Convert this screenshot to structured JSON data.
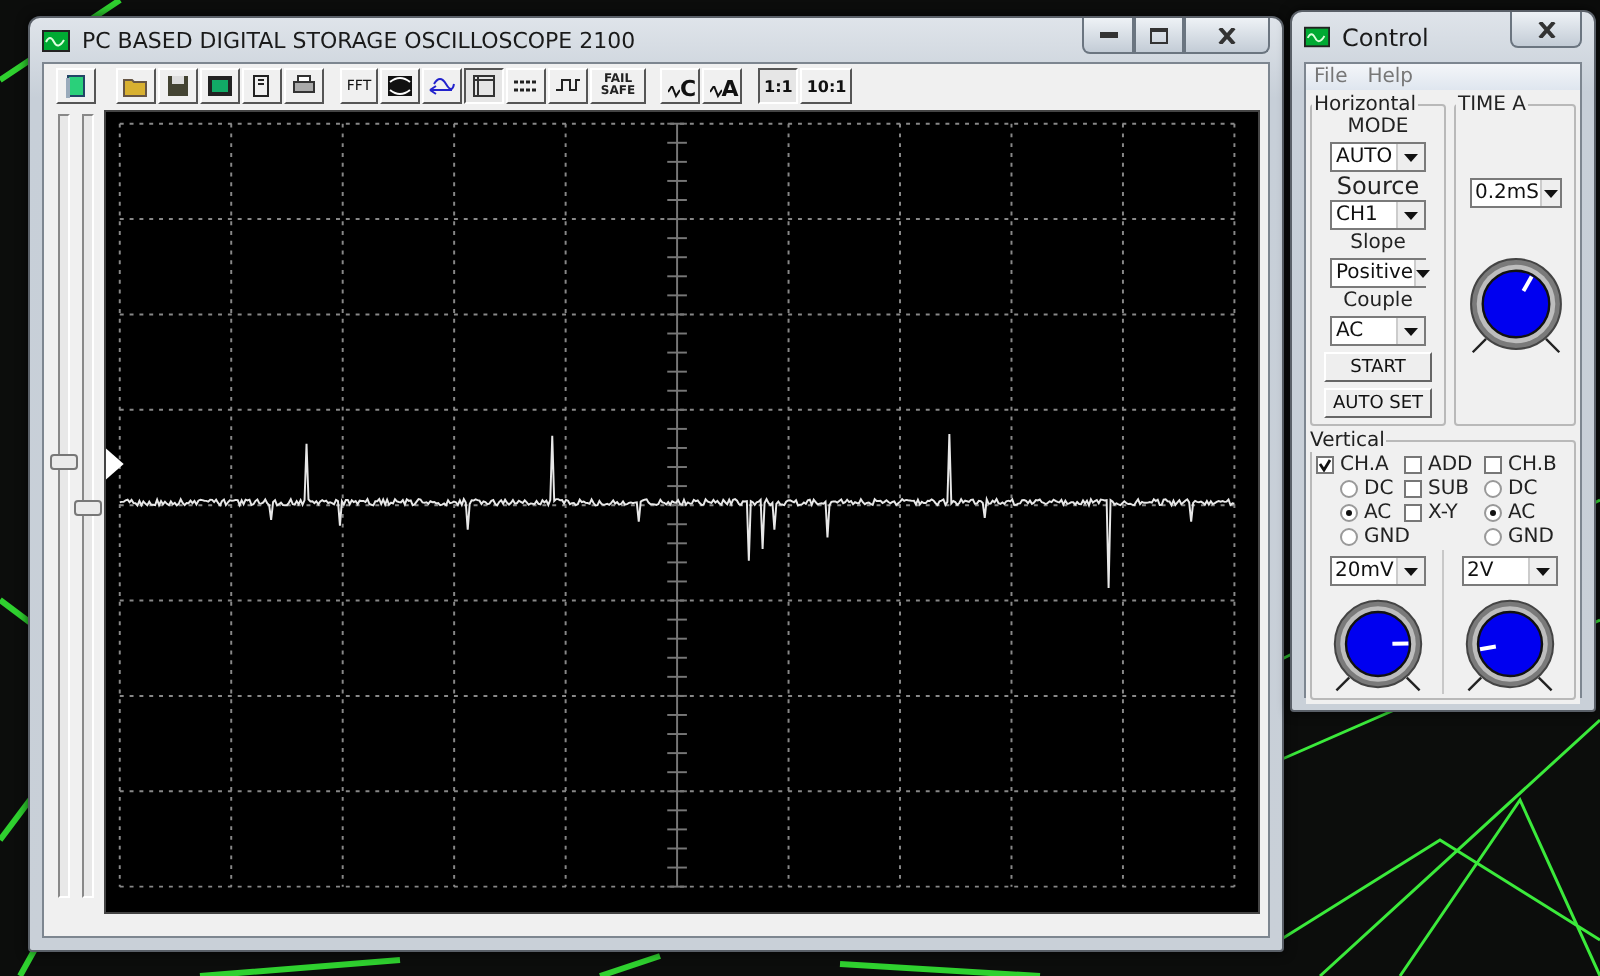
{
  "main_window": {
    "title": "PC BASED DIGITAL STORAGE OSCILLOSCOPE 2100"
  },
  "toolbar": {
    "fft_label": "FFT",
    "grid_pressed": true,
    "fail_safe_label": "FAIL SAFE",
    "trigger_buttons": [
      "C",
      "A"
    ],
    "scale_buttons": [
      {
        "label": "1:1",
        "selected": true
      },
      {
        "label": "10:1",
        "selected": false
      }
    ]
  },
  "scope": {
    "position_sliders": [
      {
        "level": 0.56
      },
      {
        "level": 0.5
      }
    ]
  },
  "control_window": {
    "title": "Control",
    "menu": [
      "File",
      "Help"
    ],
    "horizontal": {
      "title": "Horizontal",
      "fields": [
        {
          "label": "MODE",
          "value": "AUTO"
        },
        {
          "label": "Source",
          "value": "CH1"
        },
        {
          "label": "Slope",
          "value": "Positive"
        },
        {
          "label": "Couple",
          "value": "AC"
        }
      ],
      "buttons": [
        "START",
        "AUTO SET"
      ]
    },
    "time_a": {
      "title": "TIME A",
      "value": "0.2mS",
      "knob": {
        "level": 0.61
      }
    },
    "vertical": {
      "title": "Vertical",
      "math": [
        {
          "label": "ADD",
          "checked": false
        },
        {
          "label": "SUB",
          "checked": false
        },
        {
          "label": "X-Y",
          "checked": false
        }
      ],
      "channels": [
        {
          "label": "CH.A",
          "checked": true,
          "couplings": [
            {
              "label": "DC",
              "selected": false
            },
            {
              "label": "AC",
              "selected": true
            },
            {
              "label": "GND",
              "selected": false
            }
          ],
          "value": "20mV",
          "knob": {
            "level": 0.83
          }
        },
        {
          "label": "CH.B",
          "checked": false,
          "couplings": [
            {
              "label": "DC",
              "selected": false
            },
            {
              "label": "AC",
              "selected": true
            },
            {
              "label": "GND",
              "selected": false
            }
          ],
          "value": "2V",
          "knob": {
            "level": 0.13
          }
        }
      ]
    }
  }
}
